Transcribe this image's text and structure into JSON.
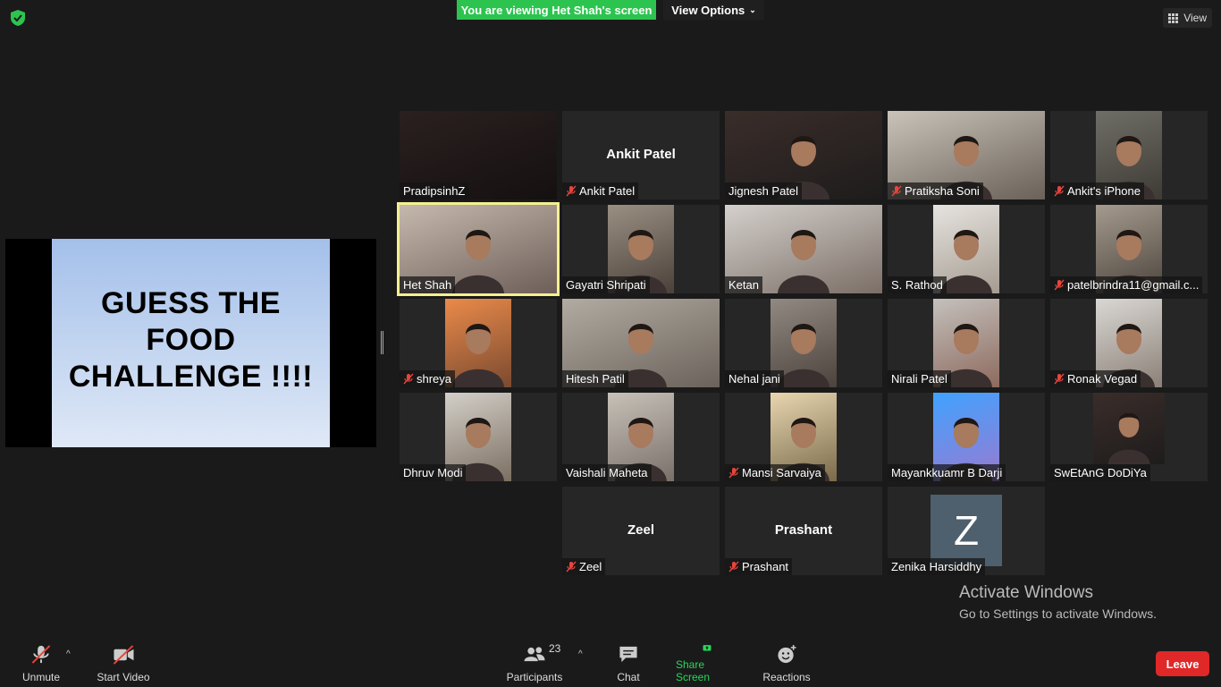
{
  "top": {
    "banner": "You are viewing Het Shah's screen",
    "view_options": "View Options",
    "view": "View"
  },
  "shared_screen": {
    "slide_text": "GUESS THE\nFOOD\nCHALLENGE !!!!"
  },
  "tiles": [
    {
      "name": "PradipsinhZ",
      "muted": false,
      "kind": "video-dark"
    },
    {
      "name": "Ankit Patel",
      "muted": true,
      "kind": "name",
      "big": "Ankit Patel"
    },
    {
      "name": "Jignesh Patel",
      "muted": false,
      "kind": "video"
    },
    {
      "name": "Pratiksha Soni",
      "muted": true,
      "kind": "video"
    },
    {
      "name": "Ankit's iPhone",
      "muted": true,
      "kind": "video"
    },
    {
      "name": "Het Shah",
      "muted": false,
      "kind": "video",
      "active": true
    },
    {
      "name": "Gayatri Shripati",
      "muted": false,
      "kind": "video"
    },
    {
      "name": "Ketan",
      "muted": false,
      "kind": "video"
    },
    {
      "name": "S. Rathod",
      "muted": false,
      "kind": "video"
    },
    {
      "name": "patelbrindra11@gmail.c...",
      "muted": true,
      "kind": "video"
    },
    {
      "name": "shreya",
      "muted": true,
      "kind": "video"
    },
    {
      "name": "Hitesh Patil",
      "muted": false,
      "kind": "video"
    },
    {
      "name": "Nehal jani",
      "muted": false,
      "kind": "video"
    },
    {
      "name": "Nirali Patel",
      "muted": false,
      "kind": "video"
    },
    {
      "name": "Ronak Vegad",
      "muted": true,
      "kind": "video"
    },
    {
      "name": "Dhruv Modi",
      "muted": false,
      "kind": "video"
    },
    {
      "name": "Vaishali Maheta",
      "muted": false,
      "kind": "video"
    },
    {
      "name": "Mansi Sarvaiya",
      "muted": true,
      "kind": "video"
    },
    {
      "name": "Mayankkuamr B Darji",
      "muted": false,
      "kind": "video"
    },
    {
      "name": "SwEtAnG DoDiYa",
      "muted": false,
      "kind": "video"
    },
    {
      "name": "Zeel",
      "muted": true,
      "kind": "name",
      "big": "Zeel"
    },
    {
      "name": "Prashant",
      "muted": true,
      "kind": "name",
      "big": "Prashant"
    },
    {
      "name": "Zenika Harsiddhy",
      "muted": false,
      "kind": "avatar",
      "initial": "Z"
    }
  ],
  "watermark": {
    "line1": "Activate Windows",
    "line2": "Go to Settings to activate Windows."
  },
  "toolbar": {
    "unmute": "Unmute",
    "start_video": "Start Video",
    "participants": "Participants",
    "participants_count": "23",
    "chat": "Chat",
    "share_screen": "Share Screen",
    "reactions": "Reactions",
    "leave": "Leave"
  },
  "colors": {
    "banner": "#2cc44f",
    "active_speaker": "#f3f091",
    "muted_icon": "#e8453c",
    "leave": "#e02828",
    "share_green": "#23d959"
  }
}
